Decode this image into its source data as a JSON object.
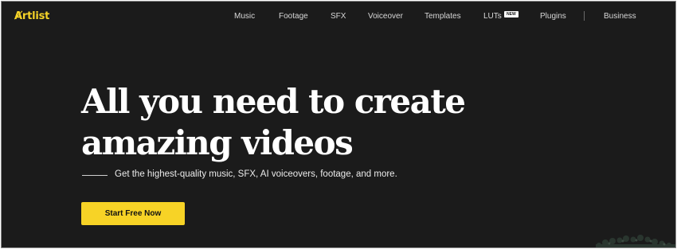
{
  "header": {
    "logo_text": "Ⱥrtlist",
    "brand_color": "#f5d328",
    "nav": [
      {
        "label": "Music"
      },
      {
        "label": "Footage"
      },
      {
        "label": "SFX"
      },
      {
        "label": "Voiceover"
      },
      {
        "label": "Templates"
      },
      {
        "label": "LUTs",
        "badge": "NEW"
      },
      {
        "label": "Plugins"
      },
      {
        "label": "Business"
      }
    ]
  },
  "hero": {
    "headline_line1": "All you need to create",
    "headline_line2": "amazing videos",
    "subtitle": "Get the highest-quality music, SFX, AI voiceovers, footage, and more.",
    "cta_label": "Start Free Now",
    "cta_color": "#f7d326"
  },
  "theme": {
    "background": "#1b1b1b",
    "text": "#ffffff"
  }
}
